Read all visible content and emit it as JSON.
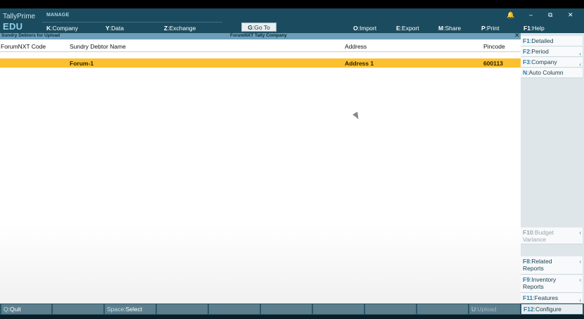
{
  "app": {
    "brand_line1": "TallyPrime",
    "brand_line2": "EDU",
    "section": "MANAGE"
  },
  "top_menu": [
    {
      "key": "K",
      "label": "Company"
    },
    {
      "key": "Y",
      "label": "Data"
    },
    {
      "key": "Z",
      "label": "Exchange"
    },
    {
      "key": "G",
      "label": "Go To"
    },
    {
      "key": "O",
      "label": "Import"
    },
    {
      "key": "E",
      "label": "Export"
    },
    {
      "key": "M",
      "label": "Share"
    },
    {
      "key": "P",
      "label": "Print"
    },
    {
      "key": "F1",
      "label": "Help"
    }
  ],
  "window_controls": {
    "bell": "🔔",
    "minimize": "–",
    "restore": "⧉",
    "close": "✕"
  },
  "report": {
    "title": "Sundry Debtors for Upload",
    "company": "ForumNXT Tally Company",
    "close": "✕",
    "columns": [
      "ForumNXT Code",
      "Sundry Debtor Name",
      "Address",
      "Pincode"
    ],
    "rows": [
      {
        "code": "",
        "name": "Forum-1",
        "address": "Address 1",
        "pincode": "600113"
      }
    ]
  },
  "right_panel": [
    {
      "key": "F1",
      "label": "Detailed"
    },
    {
      "key": "F2",
      "label": "Period",
      "arrow": "‹"
    },
    {
      "key": "F3",
      "label": "Company",
      "arrow": "‹"
    },
    {
      "key": "N",
      "label": "Auto Column"
    },
    {
      "key": "F10",
      "label": "Budget Variance",
      "arrow": "‹"
    },
    {
      "key": "F8",
      "label": "Related Reports",
      "arrow": "‹"
    },
    {
      "key": "F9",
      "label": "Inventory Reports",
      "arrow": "‹"
    },
    {
      "key": "F11",
      "label": "Features",
      "arrow": "‹"
    },
    {
      "key": "F12",
      "label": "Configure",
      "arrow": "‹"
    }
  ],
  "bottom_bar": [
    {
      "key": "Q",
      "label": "Quit"
    },
    {
      "key": "Space",
      "label": "Select"
    },
    {
      "key": "U",
      "label": "Upload"
    }
  ],
  "colors": {
    "header_bg": "#1b4b5e",
    "highlight_row": "#fbc02d",
    "title_strip": "#6c9fb7"
  }
}
